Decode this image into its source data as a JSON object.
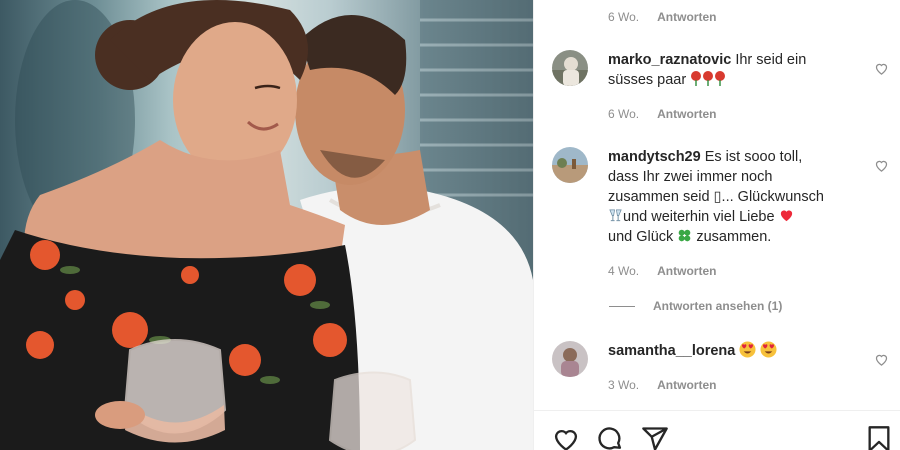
{
  "top_meta": {
    "time": "6 Wo.",
    "reply_label": "Antworten"
  },
  "comments": [
    {
      "username": "marko_raznatovic",
      "text_line1": "Ihr seid ein",
      "text_line2": "süsses paar",
      "emoji": "rose-emoji x3",
      "time": "6 Wo.",
      "reply_label": "Antworten"
    },
    {
      "username": "mandytsch29",
      "text_line1": "Es ist sooo toll,",
      "text_line2": "dass Ihr zwei immer noch",
      "text_line3": "zusammen seid ▯... Glückwunsch",
      "text_line4": "und weiterhin viel Liebe",
      "text_line5": "und Glück",
      "text_line5_end": "zusammen.",
      "emoji": [
        "clinking-glasses-emoji",
        "red-heart-emoji",
        "four-leaf-clover-emoji"
      ],
      "time": "4 Wo.",
      "reply_label": "Antworten",
      "view_replies_label": "Antworten ansehen (1)"
    },
    {
      "username": "samantha__lorena",
      "text_line1": "",
      "emoji": "heart-eyes-emoji x2",
      "time": "3 Wo.",
      "reply_label": "Antworten"
    }
  ],
  "actions": [
    "like-icon",
    "comment-icon",
    "share-icon",
    "bookmark-icon"
  ],
  "colors": {
    "text": "#262626",
    "muted": "#8e8e8e",
    "heart": "#ed4956",
    "clover": "#3aa845"
  }
}
